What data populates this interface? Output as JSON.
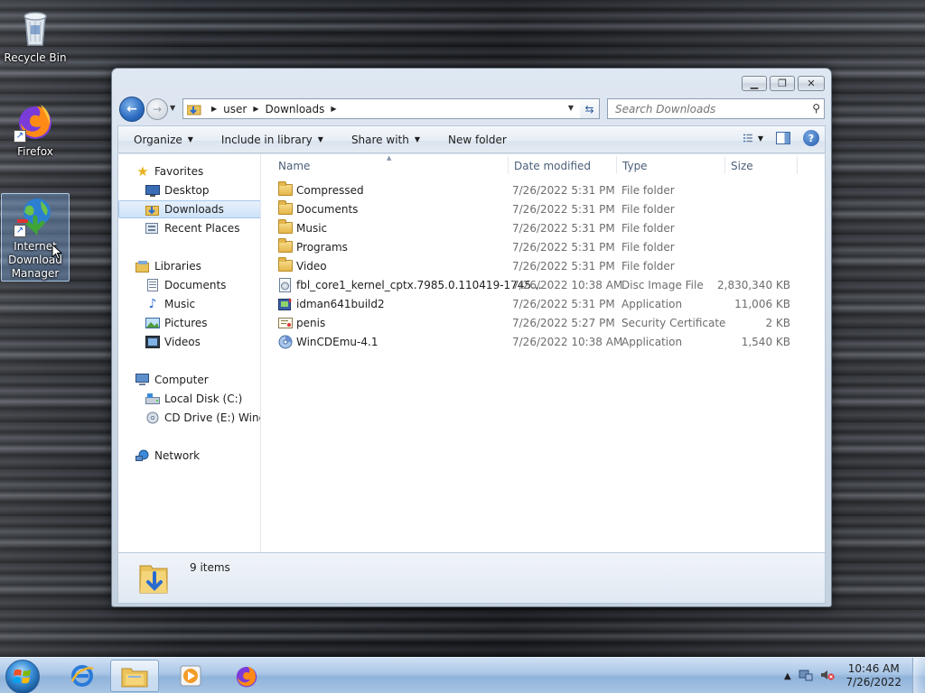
{
  "desktop": {
    "icons": [
      {
        "label": "Recycle Bin"
      },
      {
        "label": "Firefox"
      },
      {
        "label": "Internet Download Manager"
      }
    ]
  },
  "window": {
    "address": {
      "crumbs": [
        "user",
        "Downloads"
      ]
    },
    "search": {
      "placeholder": "Search Downloads"
    },
    "command_bar": {
      "organize": "Organize",
      "include_in_library": "Include in library",
      "share_with": "Share with",
      "new_folder": "New folder"
    },
    "nav_pane": {
      "favorites": "Favorites",
      "desktop": "Desktop",
      "downloads": "Downloads",
      "recent_places": "Recent Places",
      "libraries": "Libraries",
      "documents": "Documents",
      "music": "Music",
      "pictures": "Pictures",
      "videos": "Videos",
      "computer": "Computer",
      "local_disk": "Local Disk (C:)",
      "cd_drive": "CD Drive (E:) Windo",
      "network": "Network"
    },
    "columns": {
      "name": "Name",
      "date_modified": "Date modified",
      "type": "Type",
      "size": "Size"
    },
    "files": [
      {
        "name": "Compressed",
        "date": "7/26/2022 5:31 PM",
        "type": "File folder",
        "size": "",
        "icon": "folder-icon"
      },
      {
        "name": "Documents",
        "date": "7/26/2022 5:31 PM",
        "type": "File folder",
        "size": "",
        "icon": "folder-icon"
      },
      {
        "name": "Music",
        "date": "7/26/2022 5:31 PM",
        "type": "File folder",
        "size": "",
        "icon": "folder-icon"
      },
      {
        "name": "Programs",
        "date": "7/26/2022 5:31 PM",
        "type": "File folder",
        "size": "",
        "icon": "folder-icon"
      },
      {
        "name": "Video",
        "date": "7/26/2022 5:31 PM",
        "type": "File folder",
        "size": "",
        "icon": "folder-icon"
      },
      {
        "name": "fbl_core1_kernel_cptx.7985.0.110419-1745...",
        "date": "7/26/2022 10:38 AM",
        "type": "Disc Image File",
        "size": "2,830,340 KB",
        "icon": "disc-image-icon"
      },
      {
        "name": "idman641build2",
        "date": "7/26/2022 5:31 PM",
        "type": "Application",
        "size": "11,006 KB",
        "icon": "installer-icon"
      },
      {
        "name": "penis",
        "date": "7/26/2022 5:27 PM",
        "type": "Security Certificate",
        "size": "2 KB",
        "icon": "certificate-icon"
      },
      {
        "name": "WinCDEmu-4.1",
        "date": "7/26/2022 10:38 AM",
        "type": "Application",
        "size": "1,540 KB",
        "icon": "cd-app-icon"
      }
    ],
    "details": {
      "item_count": "9 items"
    }
  },
  "taskbar": {
    "clock_time": "10:46 AM",
    "clock_date": "7/26/2022"
  },
  "colors": {
    "selection": "#cde2f8",
    "accent": "#1f58ad",
    "folder": "#e4b64a"
  }
}
